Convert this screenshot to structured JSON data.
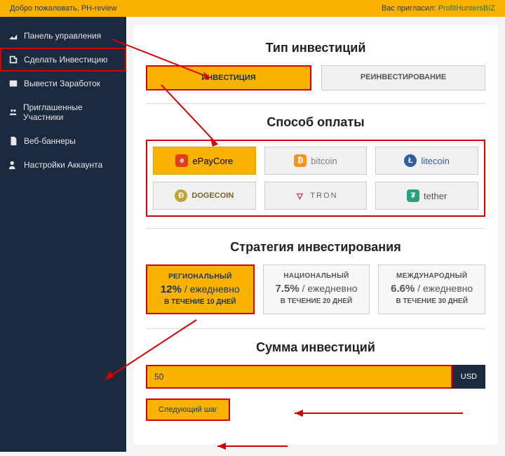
{
  "topbar": {
    "welcome": "Добро пожаловать, PH-review",
    "invited_prefix": "Вас пригласил: ",
    "inviter": "ProfitHuntersBIZ"
  },
  "sidebar": {
    "items": [
      {
        "label": "Панель управления"
      },
      {
        "label": "Сделать Инвестицию"
      },
      {
        "label": "Вывести Заработок"
      },
      {
        "label": "Приглашенные Участники"
      },
      {
        "label": "Веб-баннеры"
      },
      {
        "label": "Настройки Аккаунта"
      }
    ]
  },
  "headings": {
    "invest_type": "Тип инвестиций",
    "pay_method": "Способ оплаты",
    "strategy": "Стратегия инвестирования",
    "amount": "Сумма инвестиций"
  },
  "tabs": {
    "invest": "ИНВЕСТИЦИЯ",
    "reinvest": "РЕИНВЕСТИРОВАНИЕ"
  },
  "payments": [
    {
      "label": "ePayCore",
      "color": "#e43b1f",
      "glyph": "e"
    },
    {
      "label": "bitcoin",
      "color": "#f7931a",
      "glyph": "₿"
    },
    {
      "label": "litecoin",
      "color": "#345d9d",
      "glyph": "Ł"
    },
    {
      "label": "DOGECOIN",
      "color": "#c2a633",
      "glyph": "Ð"
    },
    {
      "label": "TRON",
      "color": "#d40f2c",
      "glyph": "▽"
    },
    {
      "label": "tether",
      "color": "#26a17b",
      "glyph": "₮"
    }
  ],
  "strategies": [
    {
      "name": "РЕГИОНАЛЬНЫЙ",
      "pct": "12%",
      "per": " / ежедневно",
      "dur": "В ТЕЧЕНИЕ 10 ДНЕЙ"
    },
    {
      "name": "НАЦИОНАЛЬНЫЙ",
      "pct": "7.5%",
      "per": " / ежедневно",
      "dur": "В ТЕЧЕНИЕ 20 ДНЕЙ"
    },
    {
      "name": "МЕЖДУНАРОДНЫЙ",
      "pct": "6.6%",
      "per": " / ежедневно",
      "dur": "В ТЕЧЕНИЕ 30 ДНЕЙ"
    }
  ],
  "amount": {
    "value": "50",
    "currency": "USD"
  },
  "buttons": {
    "next": "Следующий шаг"
  }
}
